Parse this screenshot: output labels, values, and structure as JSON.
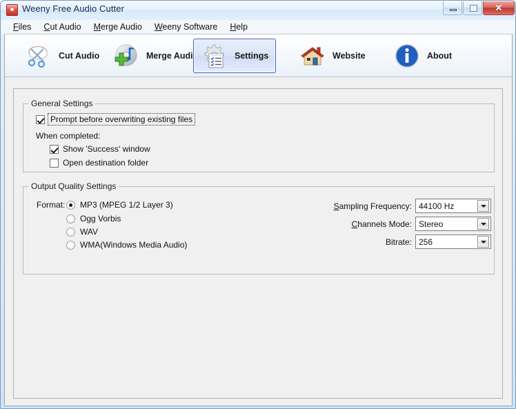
{
  "window": {
    "title": "Weeny Free Audio Cutter",
    "app_icon": "scissors-red-icon",
    "buttons": {
      "minimize": "minimize-button",
      "maximize": "maximize-button",
      "close_glyph": "✕"
    }
  },
  "menubar": {
    "items": [
      {
        "label": "Files",
        "accel": "F"
      },
      {
        "label": "Cut Audio",
        "accel": "C"
      },
      {
        "label": "Merge Audio",
        "accel": "M"
      },
      {
        "label": "Weeny Software",
        "accel": "W"
      },
      {
        "label": "Help",
        "accel": "H"
      }
    ]
  },
  "toolbar": {
    "buttons": [
      {
        "label": "Cut Audio",
        "icon": "scissors-icon",
        "active": false
      },
      {
        "label": "Merge Audio",
        "icon": "cd-music-plus-icon",
        "active": false
      },
      {
        "label": "Settings",
        "icon": "gear-checklist-icon",
        "active": true
      },
      {
        "label": "Website",
        "icon": "house-icon",
        "active": false
      },
      {
        "label": "About",
        "icon": "info-circle-icon",
        "active": false
      }
    ]
  },
  "general_settings": {
    "title": "General Settings",
    "prompt_overwrite": {
      "label": "Prompt before overwriting existing files",
      "checked": true,
      "focused": true
    },
    "when_completed_label": "When completed:",
    "show_success": {
      "label": "Show 'Success' window",
      "checked": true
    },
    "open_destination": {
      "label": "Open destination folder",
      "checked": false
    }
  },
  "output_quality_settings": {
    "title": "Output Quality Settings",
    "format_label": "Format:",
    "formats": [
      {
        "label": "MP3 (MPEG 1/2 Layer 3)",
        "selected": true
      },
      {
        "label": "Ogg Vorbis",
        "selected": false
      },
      {
        "label": "WAV",
        "selected": false
      },
      {
        "label": "WMA(Windows Media Audio)",
        "selected": false
      }
    ],
    "sampling_frequency": {
      "label": "Sampling Frequency:",
      "accel": "S",
      "value": "44100 Hz"
    },
    "channels_mode": {
      "label": "Channels Mode:",
      "accel": "C",
      "value": "Stereo"
    },
    "bitrate": {
      "label": "Bitrate:",
      "accel": "",
      "value": "256"
    }
  },
  "colors": {
    "accent": "#3b5fc0",
    "window_frame": "#7a9cc2",
    "client_bg": "#f0f0f0",
    "close_button": "#bc3a30"
  }
}
